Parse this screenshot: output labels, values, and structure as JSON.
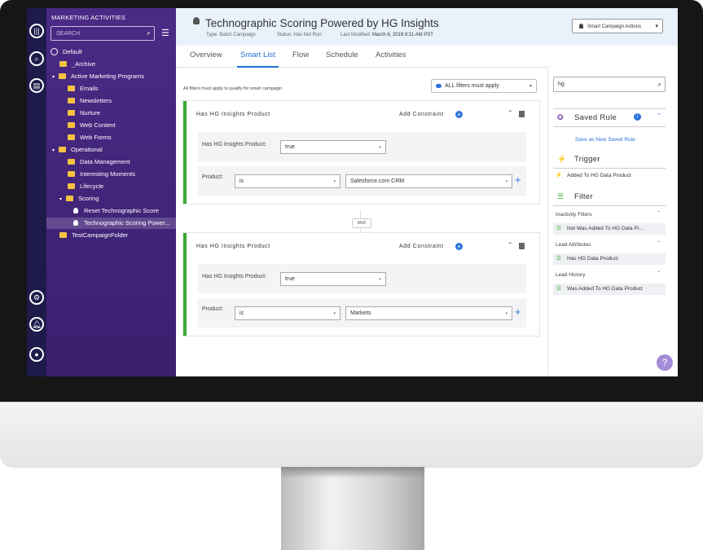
{
  "sidebar": {
    "title": "MARKETING ACTIVITIES",
    "search_placeholder": "SEARCH",
    "tree": [
      "Default",
      "_Archive",
      "Active Marketing Programs",
      "Emails",
      "Newsletters",
      "Nurture",
      "Web Content",
      "Web Forms",
      "Operational",
      "Data Management",
      "Interesting Moments",
      "Lifecycle",
      "Scoring",
      "Reset Technographic Score",
      "Technographic Scoring Power...",
      "TestCampaignFolder"
    ]
  },
  "header": {
    "title": "Technographic Scoring Powered by HG Insights",
    "type": "Type: Batch Campaign",
    "status": "Status: Has Not Run",
    "modified_label": "Last Modified:",
    "modified_value": "March 6, 2019 8:11 AM PST",
    "actions_label": "Smart Campaign Actions"
  },
  "tabs": [
    "Overview",
    "Smart List",
    "Flow",
    "Schedule",
    "Activities"
  ],
  "main": {
    "note": "All filters must apply to qualify for smart campaign",
    "all_filters": "ALL filters must apply",
    "filters": [
      {
        "title": "Has HG Insights Product",
        "add_constraint": "Add Constraint",
        "field_label": "Has HG Insights Product:",
        "field_value": "true",
        "product_label": "Product:",
        "operator": "is",
        "product_value": "Salesforce.com CRM"
      },
      {
        "title": "Has HG Insights Product",
        "add_constraint": "Add Constraint",
        "field_label": "Has HG Insights Product:",
        "field_value": "true",
        "product_label": "Product:",
        "operator": "is",
        "product_value": "Marketo"
      }
    ],
    "and_label": "AND"
  },
  "side": {
    "search_value": "hg",
    "saved_rule": "Saved Rule",
    "save_new": "Save as New Saved Rule",
    "trigger": "Trigger",
    "trigger_item": "Added To HG Data Product",
    "filter": "Filter",
    "cat1": "Inactivity Filters",
    "cat1_item": "Not Was Added To HG Data Pr...",
    "cat2": "Lead Attributes",
    "cat2_item": "Has HG Data Product",
    "cat3": "Lead History",
    "cat3_item": "Was Added To HG Data Product"
  },
  "help": "?"
}
